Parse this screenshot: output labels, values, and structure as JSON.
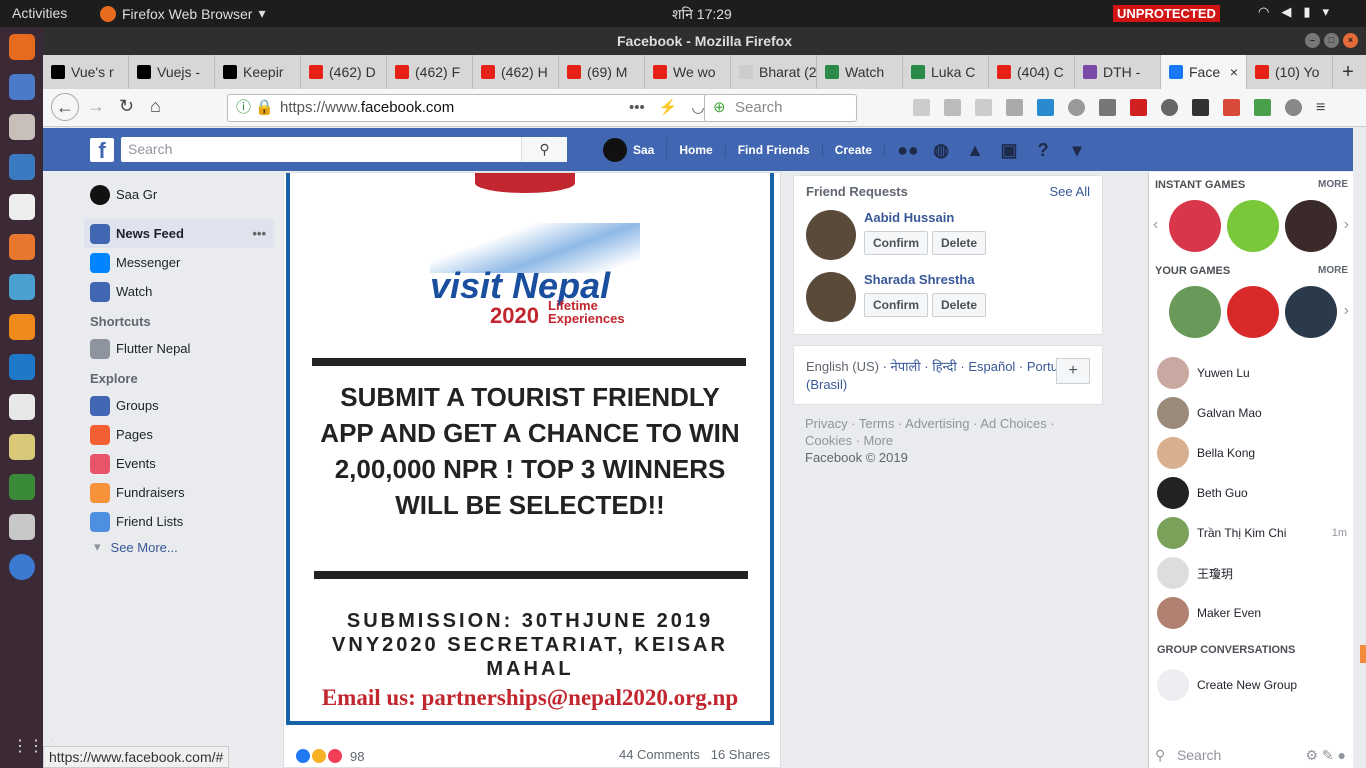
{
  "os": {
    "activities": "Activities",
    "app_menu": "Firefox Web Browser",
    "clock": "शनि 17:29",
    "unprotected": "UNPROTECTED"
  },
  "window": {
    "title": "Facebook - Mozilla Firefox"
  },
  "tabs": [
    {
      "label": "Vue's r",
      "color": "#000000"
    },
    {
      "label": "Vuejs -",
      "color": "#000000"
    },
    {
      "label": "Keepir",
      "color": "#000000"
    },
    {
      "label": "(462) D",
      "color": "#e62117"
    },
    {
      "label": "(462) F",
      "color": "#e62117"
    },
    {
      "label": "(462) H",
      "color": "#e62117"
    },
    {
      "label": "(69) M",
      "color": "#e62117"
    },
    {
      "label": "We wo",
      "color": "#e62117"
    },
    {
      "label": "Bharat (2",
      "color": "#cccccc"
    },
    {
      "label": "Watch",
      "color": "#2a8a4a"
    },
    {
      "label": "Luka C",
      "color": "#2a8a4a"
    },
    {
      "label": "(404) C",
      "color": "#e62117"
    },
    {
      "label": "DTH -",
      "color": "#7a4aa8"
    },
    {
      "label": "Face",
      "color": "#1877f2",
      "active": true
    },
    {
      "label": "(10) Yo",
      "color": "#e62117"
    }
  ],
  "nav": {
    "url_prefix": "https://www.",
    "url_domain": "facebook.com",
    "search_placeholder": "Search"
  },
  "fb": {
    "search_placeholder": "Search",
    "user": "Saa",
    "home": "Home",
    "find_friends": "Find Friends",
    "create": "Create"
  },
  "left": {
    "profile": "Saa Gr",
    "main": [
      {
        "label": "News Feed",
        "color": "#4267b2"
      },
      {
        "label": "Messenger",
        "color": "#0084ff"
      },
      {
        "label": "Watch",
        "color": "#4267b2"
      }
    ],
    "shortcuts_title": "Shortcuts",
    "shortcuts": [
      {
        "label": "Flutter Nepal",
        "color": "#8d949e"
      }
    ],
    "explore_title": "Explore",
    "explore": [
      {
        "label": "Groups",
        "color": "#4267b2"
      },
      {
        "label": "Pages",
        "color": "#f25f33"
      },
      {
        "label": "Events",
        "color": "#e9546a"
      },
      {
        "label": "Fundraisers",
        "color": "#f7923b"
      },
      {
        "label": "Friend Lists",
        "color": "#4d8fe0"
      }
    ],
    "see_more": "See More..."
  },
  "post": {
    "logo_visit": "visit",
    "logo_nepal": "Nepal",
    "logo_year": "2020",
    "logo_tag1": "Lifetime",
    "logo_tag2": "Experiences",
    "headline": "SUBMIT A TOURIST FRIENDLY APP AND GET A CHANCE TO WIN 2,00,000 NPR ! TOP 3 WINNERS WILL BE SELECTED!!",
    "submission": "SUBMISSION: 30THJUNE 2019 VNY2020 SECRETARIAT, KEISAR MAHAL",
    "email": "Email us: partnerships@nepal2020.org.np",
    "reactions": "98",
    "comments": "44 Comments",
    "shares": "16 Shares"
  },
  "right": {
    "fr_title": "Friend Requests",
    "see_all": "See All",
    "requests": [
      {
        "name": "Aabid Hussain",
        "confirm": "Confirm",
        "delete": "Delete"
      },
      {
        "name": "Sharada Shrestha",
        "confirm": "Confirm",
        "delete": "Delete"
      }
    ],
    "lang_current": "English (US)",
    "lang_other": "नेपाली · हिन्दी · Español · Português (Brasil)",
    "footer_links": "Privacy · Terms · Advertising · Ad Choices · Cookies · More",
    "copyright": "Facebook © 2019"
  },
  "chat": {
    "instant_games": "INSTANT GAMES",
    "your_games": "YOUR GAMES",
    "more": "MORE",
    "contacts": [
      {
        "name": "Yuwen Lu",
        "time": ""
      },
      {
        "name": "Galvan Mao",
        "time": ""
      },
      {
        "name": "Bella Kong",
        "time": ""
      },
      {
        "name": "Beth Guo",
        "time": ""
      },
      {
        "name": "Trần Thị Kim Chi",
        "time": "1m"
      },
      {
        "name": "王瓊玥",
        "time": ""
      },
      {
        "name": "Maker Even",
        "time": ""
      }
    ],
    "group_title": "GROUP CONVERSATIONS",
    "create_group": "Create New Group",
    "search_placeholder": "Search"
  },
  "status_url": "https://www.facebook.com/#"
}
